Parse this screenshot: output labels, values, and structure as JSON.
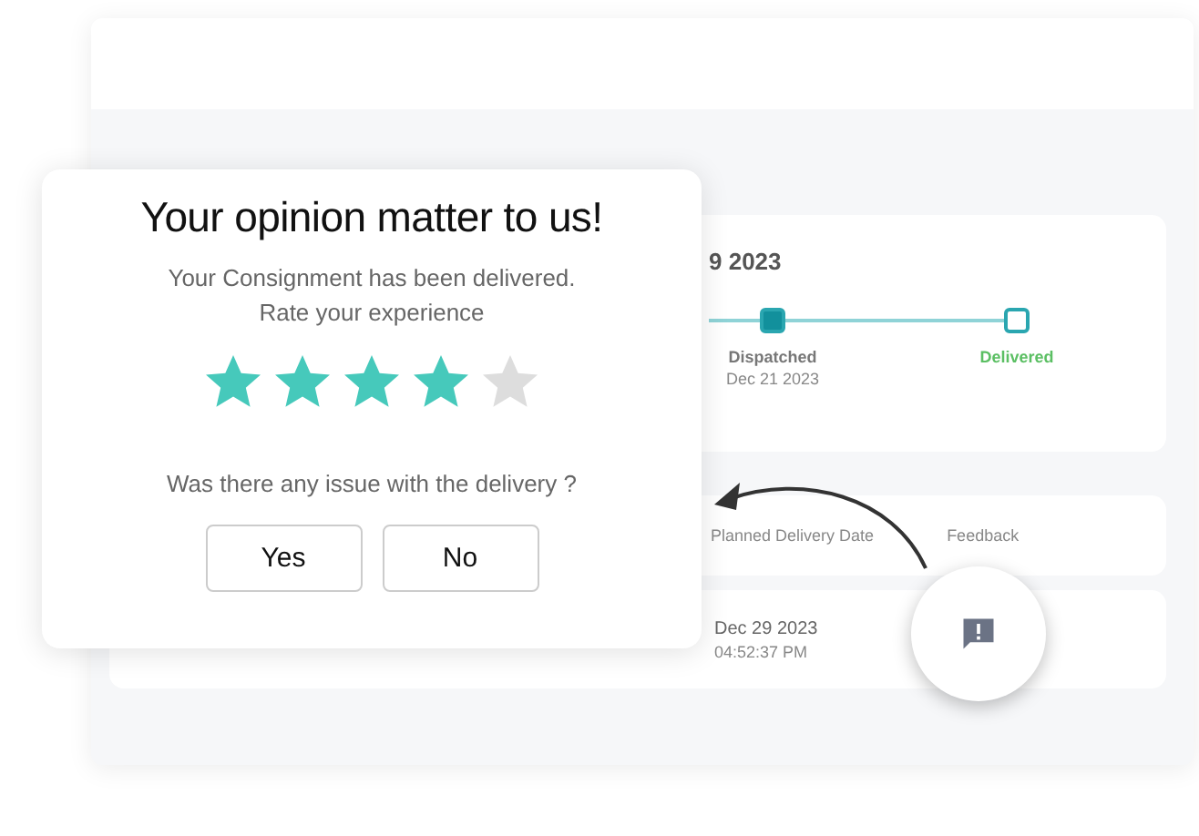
{
  "tracking": {
    "date_title": "9 2023",
    "steps": [
      {
        "label": "Dispatched",
        "date": "Dec 21 2023",
        "done": true
      },
      {
        "label": "Delivered",
        "done": false
      }
    ]
  },
  "table": {
    "columns": [
      "Planned Delivery Date",
      "Feedback"
    ],
    "row": {
      "date": "Dec 29 2023",
      "time": "04:52:37 PM"
    }
  },
  "feedback_dialog": {
    "title": "Your opinion matter to us!",
    "message": "Your Consignment has been delivered.",
    "prompt": "Rate your experience",
    "stars": 4,
    "question": "Was there any issue with the delivery ?",
    "buttons": [
      "Yes",
      "No"
    ]
  }
}
